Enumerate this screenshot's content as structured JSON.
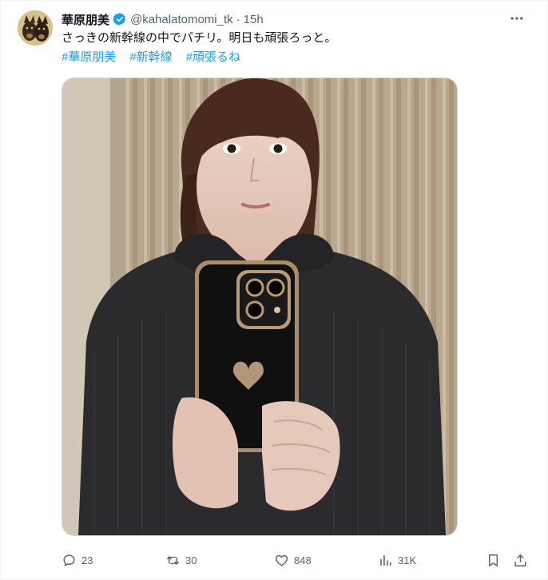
{
  "tweet": {
    "display_name": "華原朋美",
    "handle": "@kahalatomomi_tk",
    "separator": "·",
    "time": "15h",
    "text": "さっきの新幹線の中でパチリ。明日も頑張ろっと。",
    "hashtags": [
      "#華原朋美",
      "#新幹線",
      "#頑張るね"
    ],
    "verified": true,
    "verified_color": "#1d9bf0",
    "link_color": "#1d9bf0",
    "more_icon": "ellipsis-icon"
  },
  "actions": {
    "reply": {
      "icon": "reply-icon",
      "count": "23"
    },
    "retweet": {
      "icon": "retweet-icon",
      "count": "30"
    },
    "like": {
      "icon": "heart-icon",
      "count": "848"
    },
    "views": {
      "icon": "views-chart-icon",
      "count": "31K"
    },
    "bookmark": {
      "icon": "bookmark-icon"
    },
    "share": {
      "icon": "share-icon"
    }
  }
}
